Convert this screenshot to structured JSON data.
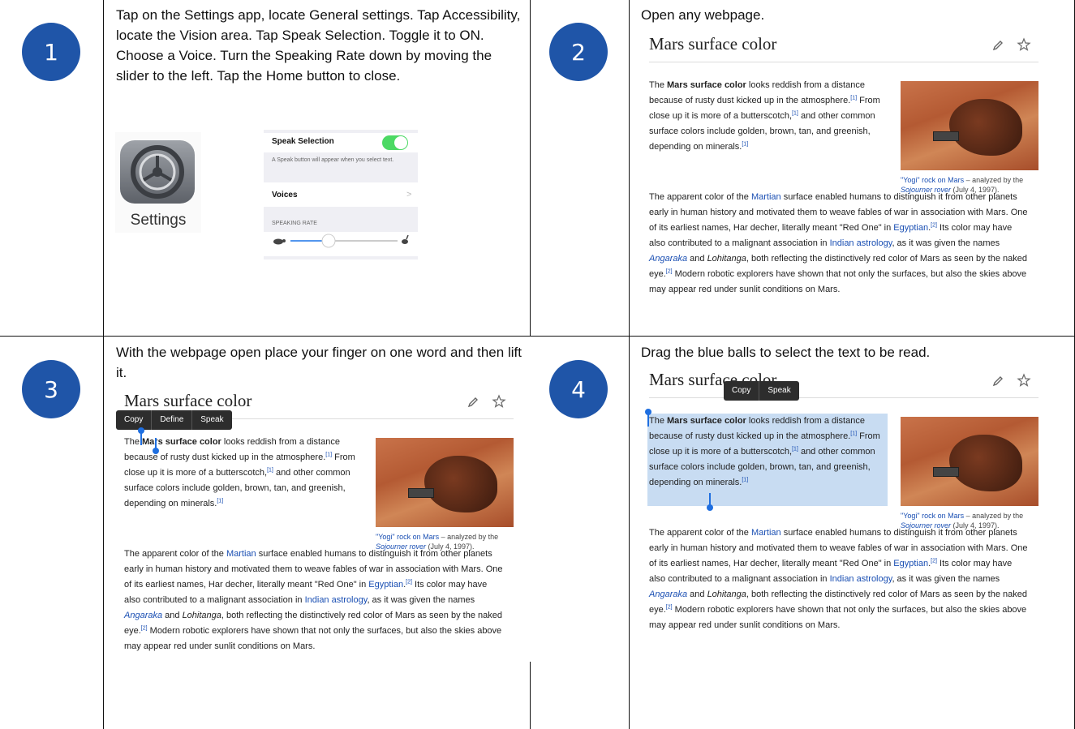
{
  "steps": [
    {
      "number": "1",
      "text": "Tap on the Settings app, locate General settings. Tap Accessibility, locate the Vision area. Tap Speak Selection.  Toggle it to ON. Choose a Voice. Turn the Speaking Rate down by moving the slider to the left.  Tap the Home button to close."
    },
    {
      "number": "2",
      "text": "Open any webpage."
    },
    {
      "number": "3",
      "text": "With the webpage open place your finger on one word and then lift it."
    },
    {
      "number": "4",
      "text": "Drag the blue balls to select the text to be read."
    }
  ],
  "settings_app": {
    "label": "Settings"
  },
  "ios_settings": {
    "speak_selection": "Speak Selection",
    "speak_selection_note": "A Speak button will appear when you select text.",
    "voices": "Voices",
    "voices_chevron": ">",
    "speaking_rate": "SPEAKING RATE",
    "toggle_on": true,
    "slider_level": 0.3
  },
  "webpage": {
    "title": "Mars surface color",
    "p1_prefix": "The ",
    "p1_bold": "Mars surface color",
    "p1_a": " looks reddish from a distance because of rusty dust kicked up in the atmosphere.",
    "ref1": "[1]",
    "p1_b": " From close up it is more of a butterscotch,",
    "p1_c": " and other common surface colors include golden, brown, tan, and greenish, depending on minerals.",
    "p2_a": "The apparent color of the ",
    "martian": "Martian",
    "p2_b": " surface enabled humans to distinguish it from other planets early in human history and motivated them to weave fables of war in association with Mars. One of its earliest names, Har decher, literally meant \"Red One\" in ",
    "egyptian": "Egyptian",
    "ref2": "[2]",
    "p2_c": " Its color may have also contributed to a malignant association in ",
    "indian_astrology": "Indian astrology",
    "p2_d": ", as it was given the names ",
    "angaraka": "Angaraka",
    "p2_e": " and ",
    "lohitanga": "Lohitanga",
    "p2_f": ", both reflecting the distinctively red color of Mars as seen by the naked eye.",
    "p2_g": " Modern robotic explorers have shown that not only the surfaces, but also the skies above may appear red under sunlit conditions on Mars.",
    "caption_link": "\"Yogi\" rock on Mars",
    "caption_mid": " – analyzed by the ",
    "caption_rover": "Sojourner rover",
    "caption_date": " (July 4, 1997)."
  },
  "menu3": {
    "copy": "Copy",
    "define": "Define",
    "speak": "Speak"
  },
  "menu4": {
    "copy": "Copy",
    "speak": "Speak"
  },
  "colors": {
    "accent": "#1f55a8",
    "link": "#1a4fb3",
    "toggle": "#4cd964",
    "selection": "#c8dcf2"
  },
  "icons": [
    "pencil-icon",
    "star-icon",
    "gear-icon",
    "turtle-icon",
    "hare-icon"
  ]
}
